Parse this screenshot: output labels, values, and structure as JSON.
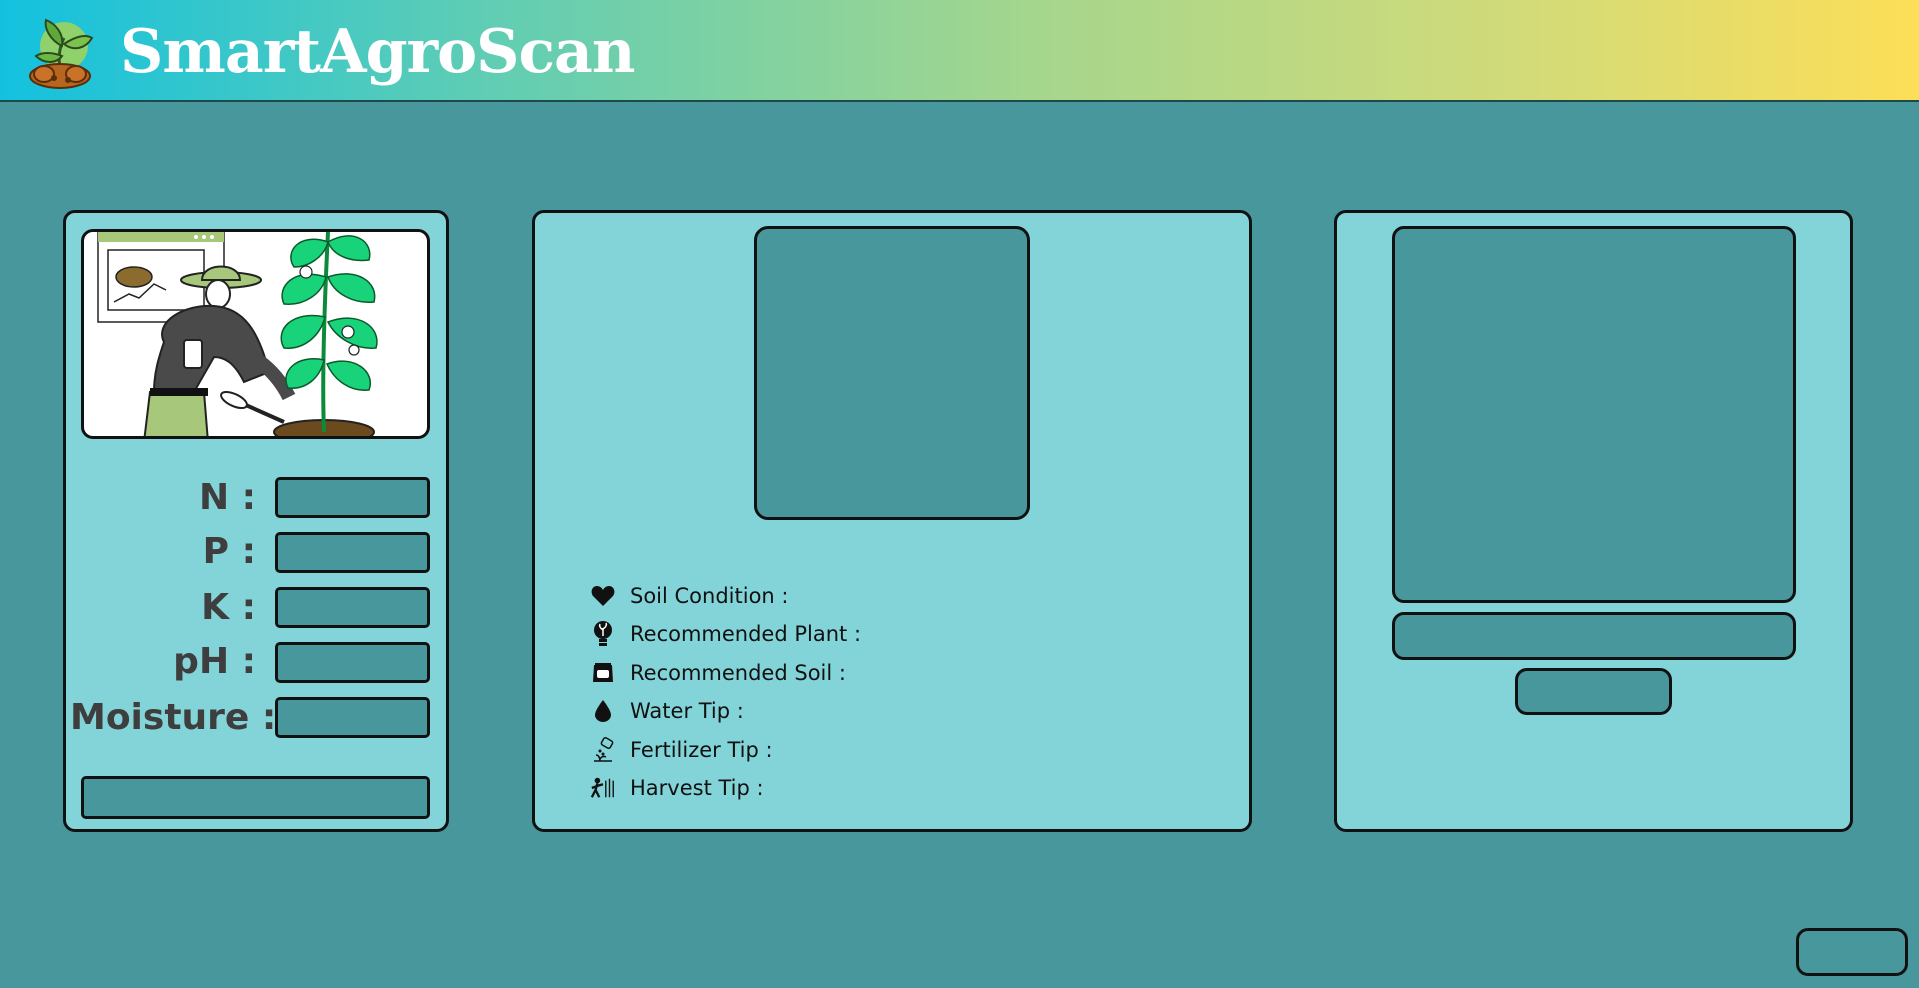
{
  "app": {
    "title": "SmartAgroScan"
  },
  "colors": {
    "background": "#47979c",
    "panel": "#83d4d8",
    "header_gradient": [
      "#13c1df",
      "#5fcdb4",
      "#a7d68c",
      "#d3db78",
      "#fdde57"
    ],
    "title": "#ffffff",
    "label": "#3e3e3e"
  },
  "input_panel": {
    "illustration_icon": "farmer-with-plant-illustration",
    "fields": [
      {
        "label": "N :",
        "value": ""
      },
      {
        "label": "P :",
        "value": ""
      },
      {
        "label": "K :",
        "value": ""
      },
      {
        "label": "pH :",
        "value": ""
      },
      {
        "label": "Moisture :",
        "value": ""
      }
    ],
    "submit_button_label": ""
  },
  "results_panel": {
    "items": [
      {
        "label": "Soil Condition :",
        "icon": "heart-icon"
      },
      {
        "label": "Recommended Plant :",
        "icon": "lightbulb-plant-icon"
      },
      {
        "label": "Recommended Soil :",
        "icon": "soil-bag-icon"
      },
      {
        "label": "Water Tip :",
        "icon": "water-drop-icon"
      },
      {
        "label": "Fertilizer Tip :",
        "icon": "fertilizer-icon"
      },
      {
        "label": "Harvest Tip :",
        "icon": "harvest-icon"
      }
    ]
  },
  "scan_panel": {
    "file_field_value": "",
    "button_label": ""
  },
  "footer": {
    "button_label": ""
  }
}
